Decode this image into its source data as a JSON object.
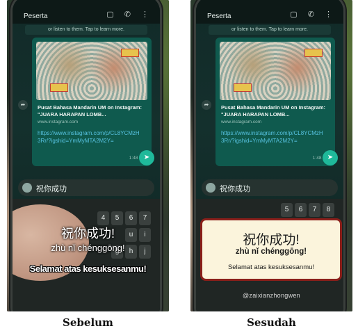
{
  "chat": {
    "contact": "Peserta",
    "banner": "or listen to them. Tap to learn more.",
    "link_title": "Pusat Bahasa Mandarin UM on Instagram: \"JUARA HARAPAN LOMB...",
    "link_domain": "www.instagram.com",
    "link_url": "https://www.instagram.com/p/CL8YCMzH3Rr/?igshid=YmMyMTA2M2Y=",
    "time": "1:48 PM",
    "input_text": "祝你成功"
  },
  "panels": {
    "before": {
      "caption": "Sebelum",
      "hanzi": "祝你成功!",
      "pinyin": "zhù nǐ chénggōng!",
      "indonesian": "Selamat atas kesuksesanmu!"
    },
    "after": {
      "caption": "Sesudah",
      "hanzi": "祝你成功!",
      "pinyin": "zhù nǐ chénggōng!",
      "indonesian": "Selamat atas kesuksesanmu!",
      "watermark": "@zaixianzhongwen"
    }
  },
  "colors": {
    "card_border": "#8a1f1a",
    "card_bg": "#fbf4dc",
    "chat_bubble": "#0f5a4e"
  }
}
